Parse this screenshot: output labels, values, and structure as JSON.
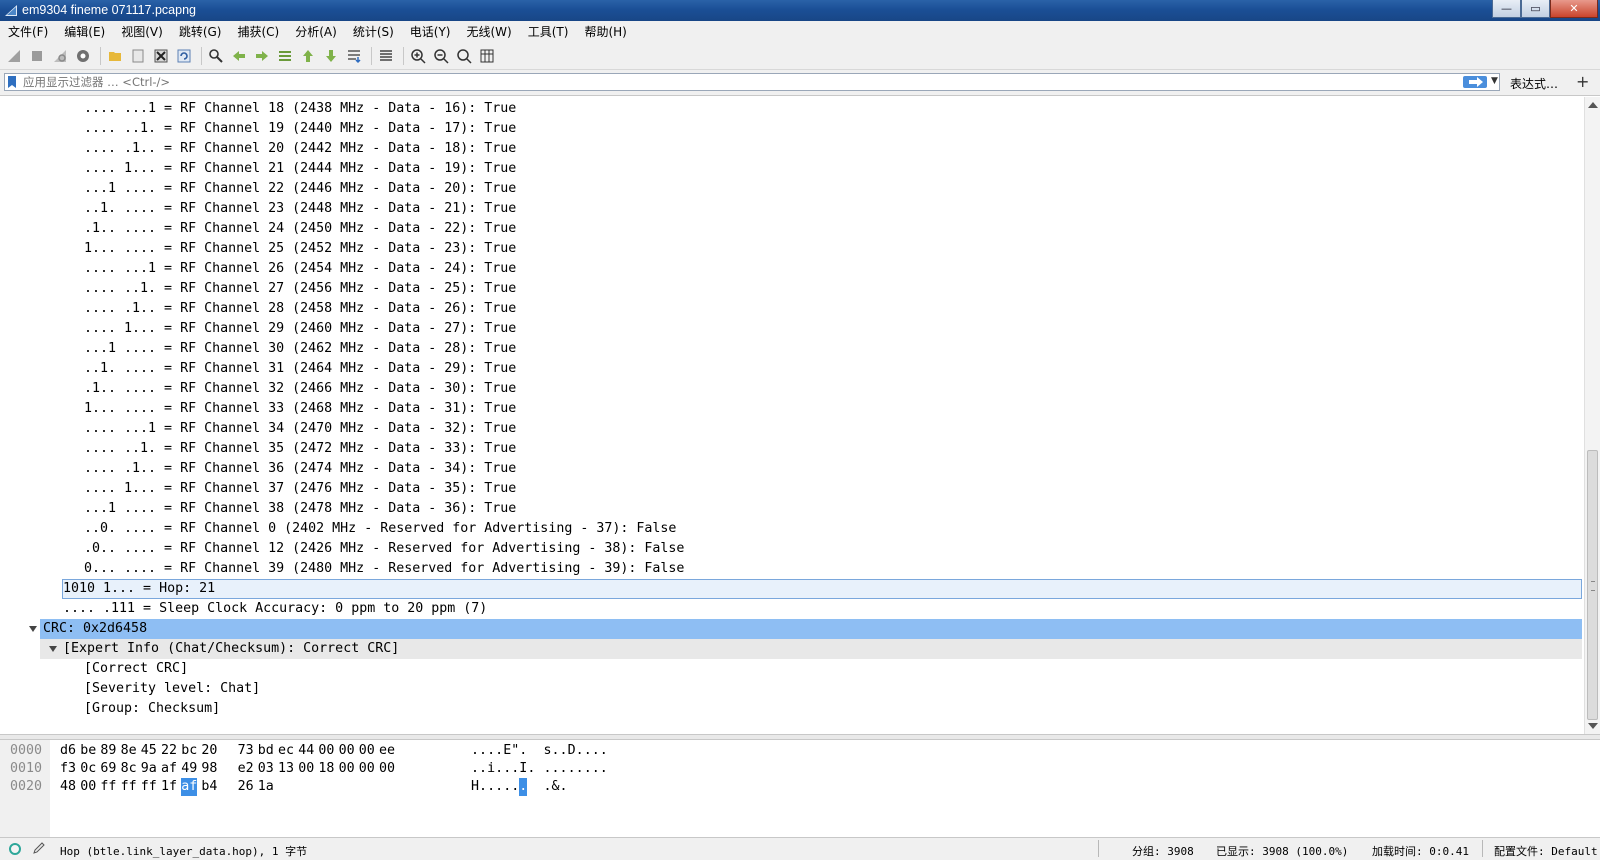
{
  "window": {
    "title": "em9304 fineme 071117.pcapng",
    "minimize": "—",
    "maximize": "▭",
    "close": "✕"
  },
  "menu": [
    "文件(F)",
    "编辑(E)",
    "视图(V)",
    "跳转(G)",
    "捕获(C)",
    "分析(A)",
    "统计(S)",
    "电话(Y)",
    "无线(W)",
    "工具(T)",
    "帮助(H)"
  ],
  "toolbar_icons": [
    "shark-fin-start-icon",
    "stop-icon",
    "restart-icon",
    "capture-options-icon",
    "open-file-icon",
    "file-set-icon",
    "close-file-icon",
    "reload-icon",
    "find-packet-icon",
    "go-back-icon",
    "go-forward-icon",
    "go-to-packet-icon",
    "go-first-icon",
    "go-last-icon",
    "auto-scroll-icon",
    "colorize-icon",
    "zoom-in-icon",
    "zoom-out-icon",
    "normal-size-icon",
    "resize-columns-icon"
  ],
  "filter": {
    "placeholder": "应用显示过滤器 … <Ctrl-/>",
    "expression_label": "表达式…",
    "add_label": "+"
  },
  "tree_rows": [
    {
      "indent": 3,
      "text": ".... ...1 = RF Channel 18 (2438 MHz - Data - 16): True"
    },
    {
      "indent": 3,
      "text": ".... ..1. = RF Channel 19 (2440 MHz - Data - 17): True"
    },
    {
      "indent": 3,
      "text": ".... .1.. = RF Channel 20 (2442 MHz - Data - 18): True"
    },
    {
      "indent": 3,
      "text": ".... 1... = RF Channel 21 (2444 MHz - Data - 19): True"
    },
    {
      "indent": 3,
      "text": "...1 .... = RF Channel 22 (2446 MHz - Data - 20): True"
    },
    {
      "indent": 3,
      "text": "..1. .... = RF Channel 23 (2448 MHz - Data - 21): True"
    },
    {
      "indent": 3,
      "text": ".1.. .... = RF Channel 24 (2450 MHz - Data - 22): True"
    },
    {
      "indent": 3,
      "text": "1... .... = RF Channel 25 (2452 MHz - Data - 23): True"
    },
    {
      "indent": 3,
      "text": ".... ...1 = RF Channel 26 (2454 MHz - Data - 24): True"
    },
    {
      "indent": 3,
      "text": ".... ..1. = RF Channel 27 (2456 MHz - Data - 25): True"
    },
    {
      "indent": 3,
      "text": ".... .1.. = RF Channel 28 (2458 MHz - Data - 26): True"
    },
    {
      "indent": 3,
      "text": ".... 1... = RF Channel 29 (2460 MHz - Data - 27): True"
    },
    {
      "indent": 3,
      "text": "...1 .... = RF Channel 30 (2462 MHz - Data - 28): True"
    },
    {
      "indent": 3,
      "text": "..1. .... = RF Channel 31 (2464 MHz - Data - 29): True"
    },
    {
      "indent": 3,
      "text": ".1.. .... = RF Channel 32 (2466 MHz - Data - 30): True"
    },
    {
      "indent": 3,
      "text": "1... .... = RF Channel 33 (2468 MHz - Data - 31): True"
    },
    {
      "indent": 3,
      "text": ".... ...1 = RF Channel 34 (2470 MHz - Data - 32): True"
    },
    {
      "indent": 3,
      "text": ".... ..1. = RF Channel 35 (2472 MHz - Data - 33): True"
    },
    {
      "indent": 3,
      "text": ".... .1.. = RF Channel 36 (2474 MHz - Data - 34): True"
    },
    {
      "indent": 3,
      "text": ".... 1... = RF Channel 37 (2476 MHz - Data - 35): True"
    },
    {
      "indent": 3,
      "text": "...1 .... = RF Channel 38 (2478 MHz - Data - 36): True"
    },
    {
      "indent": 3,
      "text": "..0. .... = RF Channel 0 (2402 MHz - Reserved for Advertising - 37): False"
    },
    {
      "indent": 3,
      "text": ".0.. .... = RF Channel 12 (2426 MHz - Reserved for Advertising - 38): False"
    },
    {
      "indent": 3,
      "text": "0... .... = RF Channel 39 (2480 MHz - Reserved for Advertising - 39): False"
    },
    {
      "indent": 2,
      "text": "1010 1... = Hop: 21",
      "state": "outline"
    },
    {
      "indent": 2,
      "text": ".... .111 = Sleep Clock Accuracy: 0 ppm to 20 ppm (7)"
    },
    {
      "indent": 1,
      "text": "CRC: 0x2d6458",
      "state": "selected",
      "expander": true
    },
    {
      "indent": 2,
      "text": "[Expert Info (Chat/Checksum): Correct CRC]",
      "state": "expert",
      "expander": true
    },
    {
      "indent": 3,
      "text": "[Correct CRC]"
    },
    {
      "indent": 3,
      "text": "[Severity level: Chat]"
    },
    {
      "indent": 3,
      "text": "[Group: Checksum]"
    }
  ],
  "bytes_rows": [
    {
      "offset": "0000",
      "hex": [
        "d6",
        "be",
        "89",
        "8e",
        "45",
        "22",
        "bc",
        "20",
        "73",
        "bd",
        "ec",
        "44",
        "00",
        "00",
        "00",
        "ee"
      ],
      "ascii": "....E\".  s..D...."
    },
    {
      "offset": "0010",
      "hex": [
        "f3",
        "0c",
        "69",
        "8c",
        "9a",
        "af",
        "49",
        "98",
        "e2",
        "03",
        "13",
        "00",
        "18",
        "00",
        "00",
        "00"
      ],
      "ascii": "..i...I. ........"
    },
    {
      "offset": "0020",
      "hex": [
        "48",
        "00",
        "ff",
        "ff",
        "ff",
        "1f",
        "af",
        "b4",
        "26",
        "1a"
      ],
      "ascii": "H......  .&.",
      "highlight_hex_index": 6,
      "highlight_ascii_index": 6
    }
  ],
  "status": {
    "message": "Hop (btle.link_layer_data.hop), 1 字节",
    "packets": "分组: 3908",
    "displayed": "已显示: 3908 (100.0%)",
    "load_time": "加载时间: 0:0.41",
    "profile": "配置文件: Default"
  }
}
